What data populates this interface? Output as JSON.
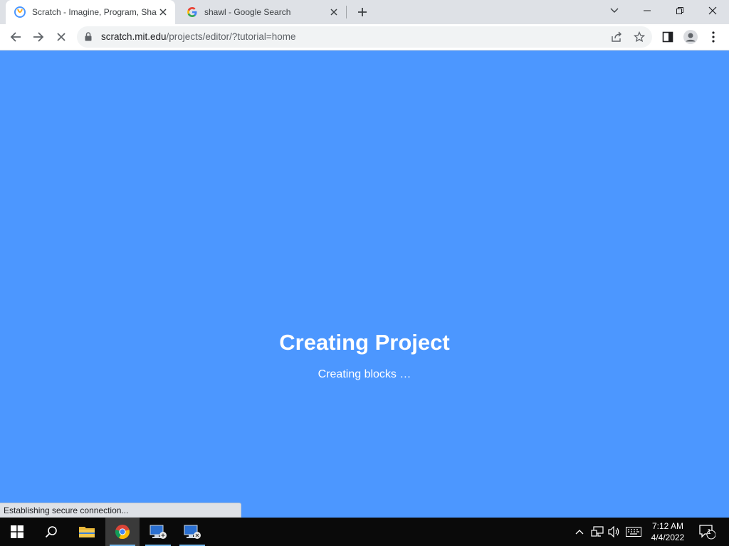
{
  "browser": {
    "tabs": [
      {
        "title": "Scratch - Imagine, Program, Share",
        "active": true,
        "favicon": "scratch-favicon"
      },
      {
        "title": "shawl - Google Search",
        "active": false,
        "favicon": "google-favicon"
      }
    ],
    "url_host": "scratch.mit.edu",
    "url_path": "/projects/editor/?tutorial=home",
    "status_text": "Establishing secure connection..."
  },
  "page": {
    "loading_title": "Creating Project",
    "loading_subtitle": "Creating blocks …",
    "background_color": "#4c97ff"
  },
  "taskbar": {
    "pinned": [
      "start-icon",
      "search-icon",
      "file-explorer-icon",
      "chrome-icon",
      "network-app-icon",
      "remote-desktop-icon"
    ],
    "clock_time": "7:12 AM",
    "clock_date": "4/4/2022",
    "notification_count": "1"
  }
}
